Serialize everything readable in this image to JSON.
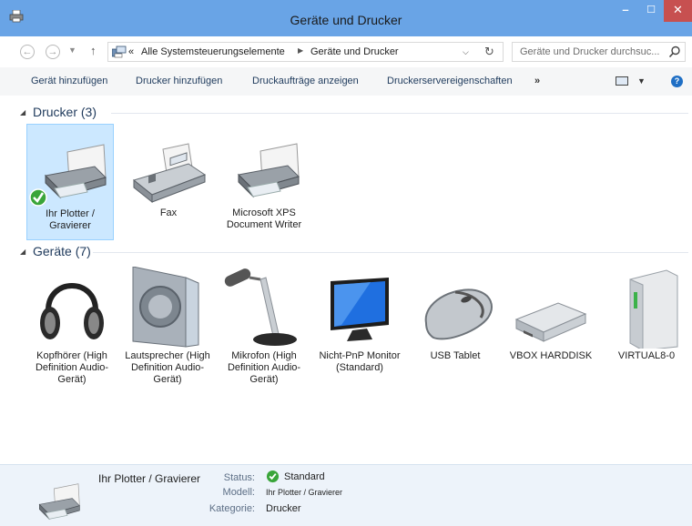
{
  "window": {
    "title": "Geräte und Drucker",
    "minimize_glyph": "–",
    "maximize_glyph": "☐",
    "close_glyph": "✕"
  },
  "address": {
    "overflow": "«",
    "crumbs": [
      "Alle Systemsteuerungselemente",
      "Geräte und Drucker"
    ],
    "search_placeholder": "Geräte und Drucker durchsuc..."
  },
  "commands": {
    "add_device": "Gerät hinzufügen",
    "add_printer": "Drucker hinzufügen",
    "print_jobs": "Druckaufträge anzeigen",
    "server_props": "Druckerservereigenschaften",
    "more": "»"
  },
  "groups": {
    "printers": {
      "title": "Drucker (3)",
      "items": [
        {
          "label": "Ihr Plotter / Gravierer",
          "icon": "printer-default-icon"
        },
        {
          "label": "Fax",
          "icon": "fax-icon"
        },
        {
          "label": "Microsoft XPS Document Writer",
          "icon": "printer-icon"
        }
      ]
    },
    "devices": {
      "title": "Geräte (7)",
      "items": [
        {
          "label": "Kopfhörer (High Definition Audio-Gerät)",
          "icon": "headphones-icon"
        },
        {
          "label": "Lautsprecher (High Definition Audio-Gerät)",
          "icon": "speaker-icon"
        },
        {
          "label": "Mikrofon (High Definition Audio-Gerät)",
          "icon": "microphone-icon"
        },
        {
          "label": "Nicht-PnP Monitor (Standard)",
          "icon": "monitor-icon"
        },
        {
          "label": "USB Tablet",
          "icon": "mouse-icon"
        },
        {
          "label": "VBOX HARDDISK",
          "icon": "harddisk-icon"
        },
        {
          "label": "VIRTUAL8-0",
          "icon": "drive-tower-icon"
        }
      ]
    }
  },
  "details": {
    "name": "Ihr Plotter / Gravierer",
    "status_key": "Status:",
    "status_value": "Standard",
    "model_key": "Modell:",
    "model_value": "Ihr Plotter / Gravierer",
    "category_key": "Kategorie:",
    "category_value": "Drucker"
  },
  "colors": {
    "titlebar": "#69a4e6",
    "close": "#c75050",
    "selection": "#cce8ff",
    "group_title": "#1e395b",
    "details_bg": "#edf3fa"
  }
}
